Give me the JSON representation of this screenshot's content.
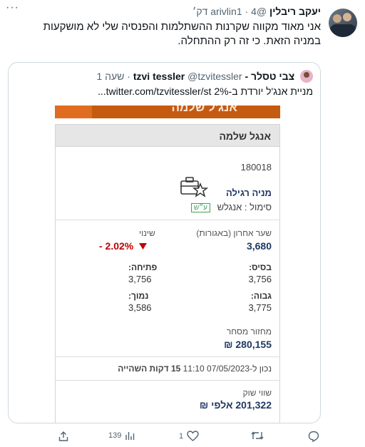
{
  "tweet": {
    "author_name": "יעקב ריבלין",
    "handle": "@arivlin1",
    "time": "4 דק׳",
    "text": "אני מאוד מקווה שקרנות ההשתלמות והפנסיה שלי לא מושקעות במניה הזאת. כי זה רק ההתחלה."
  },
  "quote": {
    "author_name": "צבי טסלר - tzvi tessler",
    "handle": "@tzvitessler",
    "time": "שעה 1",
    "text": "מניית אנג'ל יורדת ב-2%  twitter.com/tzvitessler/st..."
  },
  "stock": {
    "banner_text": "אנג'ל שלמה",
    "title": "אנגל שלמה",
    "code": "180018",
    "type": "מניה רגילה",
    "symbol_label": "סימול : אנגלש",
    "badge": "ע״ש",
    "last_label": "שער אחרון (באגורות)",
    "last_value": "3,680",
    "change_label": "שינוי",
    "change_value": "- 2.02%",
    "base_label": "בסיס:",
    "base_value": "3,756",
    "open_label": "פתיחה:",
    "open_value": "3,756",
    "high_label": "גבוה:",
    "high_value": "3,775",
    "low_label": "נמוך:",
    "low_value": "3,586",
    "volume_label": "מחזור מסחר",
    "volume_value": "280,155 ₪",
    "timestamp_prefix": "נכון ל-",
    "timestamp_date": "07/05/2023 11:10",
    "timestamp_delay": "15 דקות השהייה",
    "market_cap_label": "שווי שוק",
    "market_cap_value": "201,322 אלפי ₪"
  },
  "actions": {
    "replies": "",
    "retweets": "",
    "likes": "1",
    "views": "139"
  },
  "colors": {
    "accent_orange": "#c55a11",
    "negative_red": "#c00000",
    "value_blue": "#1f3864"
  }
}
